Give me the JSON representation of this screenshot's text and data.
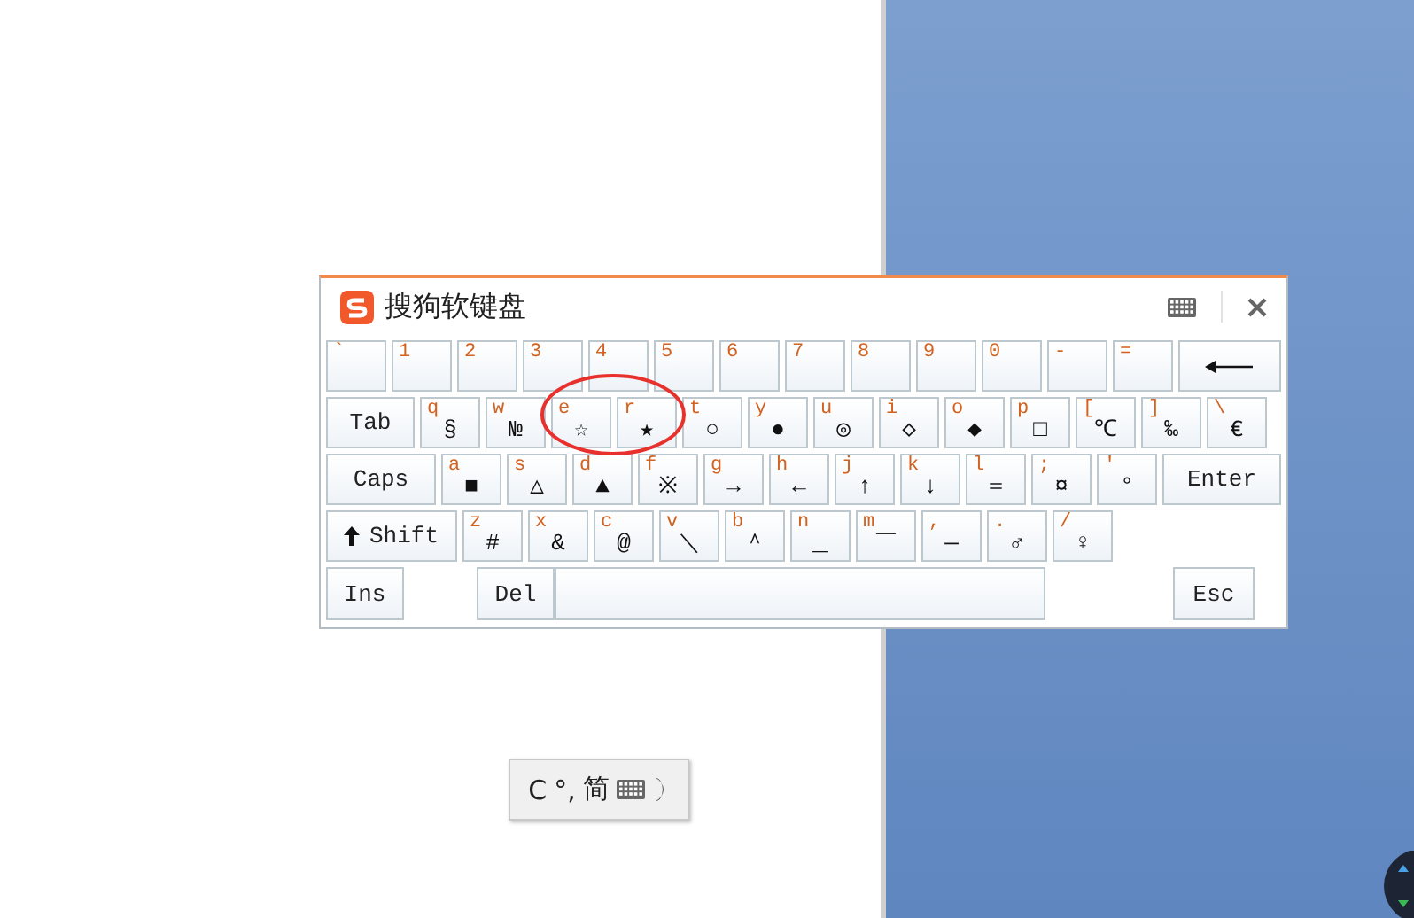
{
  "keyboard": {
    "title": "搜狗软键盘",
    "rows": [
      {
        "keys": [
          {
            "kind": "char",
            "label": "`"
          },
          {
            "kind": "char",
            "label": "1"
          },
          {
            "kind": "char",
            "label": "2"
          },
          {
            "kind": "char",
            "label": "3"
          },
          {
            "kind": "char",
            "label": "4"
          },
          {
            "kind": "char",
            "label": "5"
          },
          {
            "kind": "char",
            "label": "6"
          },
          {
            "kind": "char",
            "label": "7"
          },
          {
            "kind": "char",
            "label": "8"
          },
          {
            "kind": "char",
            "label": "9"
          },
          {
            "kind": "char",
            "label": "0"
          },
          {
            "kind": "char",
            "label": "-"
          },
          {
            "kind": "char",
            "label": "="
          },
          {
            "kind": "backspace"
          }
        ]
      },
      {
        "keys": [
          {
            "kind": "tab",
            "label": "Tab"
          },
          {
            "kind": "char",
            "label": "q",
            "symbol": "§"
          },
          {
            "kind": "char",
            "label": "w",
            "symbol": "№"
          },
          {
            "kind": "char",
            "label": "e",
            "symbol": "☆"
          },
          {
            "kind": "char",
            "label": "r",
            "symbol": "★"
          },
          {
            "kind": "char",
            "label": "t",
            "symbol": "○"
          },
          {
            "kind": "char",
            "label": "y",
            "symbol": "●"
          },
          {
            "kind": "char",
            "label": "u",
            "symbol": "◎"
          },
          {
            "kind": "char",
            "label": "i",
            "symbol": "◇"
          },
          {
            "kind": "char",
            "label": "o",
            "symbol": "◆"
          },
          {
            "kind": "char",
            "label": "p",
            "symbol": "□"
          },
          {
            "kind": "char",
            "label": "[",
            "symbol": "℃"
          },
          {
            "kind": "char",
            "label": "]",
            "symbol": "‰"
          },
          {
            "kind": "char",
            "label": "\\",
            "symbol": "€"
          }
        ]
      },
      {
        "keys": [
          {
            "kind": "caps",
            "label": "Caps"
          },
          {
            "kind": "char",
            "label": "a",
            "symbol": "■"
          },
          {
            "kind": "char",
            "label": "s",
            "symbol": "△"
          },
          {
            "kind": "char",
            "label": "d",
            "symbol": "▲"
          },
          {
            "kind": "char",
            "label": "f",
            "symbol": "※"
          },
          {
            "kind": "char",
            "label": "g",
            "symbol": "→"
          },
          {
            "kind": "char",
            "label": "h",
            "symbol": "←"
          },
          {
            "kind": "char",
            "label": "j",
            "symbol": "↑"
          },
          {
            "kind": "char",
            "label": "k",
            "symbol": "↓"
          },
          {
            "kind": "char",
            "label": "l",
            "symbol": "＝"
          },
          {
            "kind": "char",
            "label": ";",
            "symbol": "¤"
          },
          {
            "kind": "char",
            "label": "'",
            "symbol": "°"
          },
          {
            "kind": "enter",
            "label": "Enter"
          }
        ]
      },
      {
        "keys": [
          {
            "kind": "shift",
            "label": "Shift"
          },
          {
            "kind": "char",
            "label": "z",
            "symbol": "#"
          },
          {
            "kind": "char",
            "label": "x",
            "symbol": "&"
          },
          {
            "kind": "char",
            "label": "c",
            "symbol": "@"
          },
          {
            "kind": "char",
            "label": "v",
            "symbol": "＼"
          },
          {
            "kind": "char",
            "label": "b",
            "symbol": "＾"
          },
          {
            "kind": "char",
            "label": "n",
            "symbol": "＿"
          },
          {
            "kind": "char",
            "label": "m",
            "symbol": "￣"
          },
          {
            "kind": "char",
            "label": ",",
            "symbol": "—"
          },
          {
            "kind": "char",
            "label": ".",
            "symbol": "♂"
          },
          {
            "kind": "char",
            "label": "/",
            "symbol": "♀"
          }
        ]
      },
      {
        "keys": [
          {
            "kind": "ins",
            "label": "Ins"
          },
          {
            "kind": "del",
            "label": "Del"
          },
          {
            "kind": "space"
          },
          {
            "kind": "esc",
            "label": "Esc"
          }
        ]
      }
    ]
  },
  "ime_bar": {
    "mode": "C",
    "punctuation": "°,",
    "script": "简"
  }
}
